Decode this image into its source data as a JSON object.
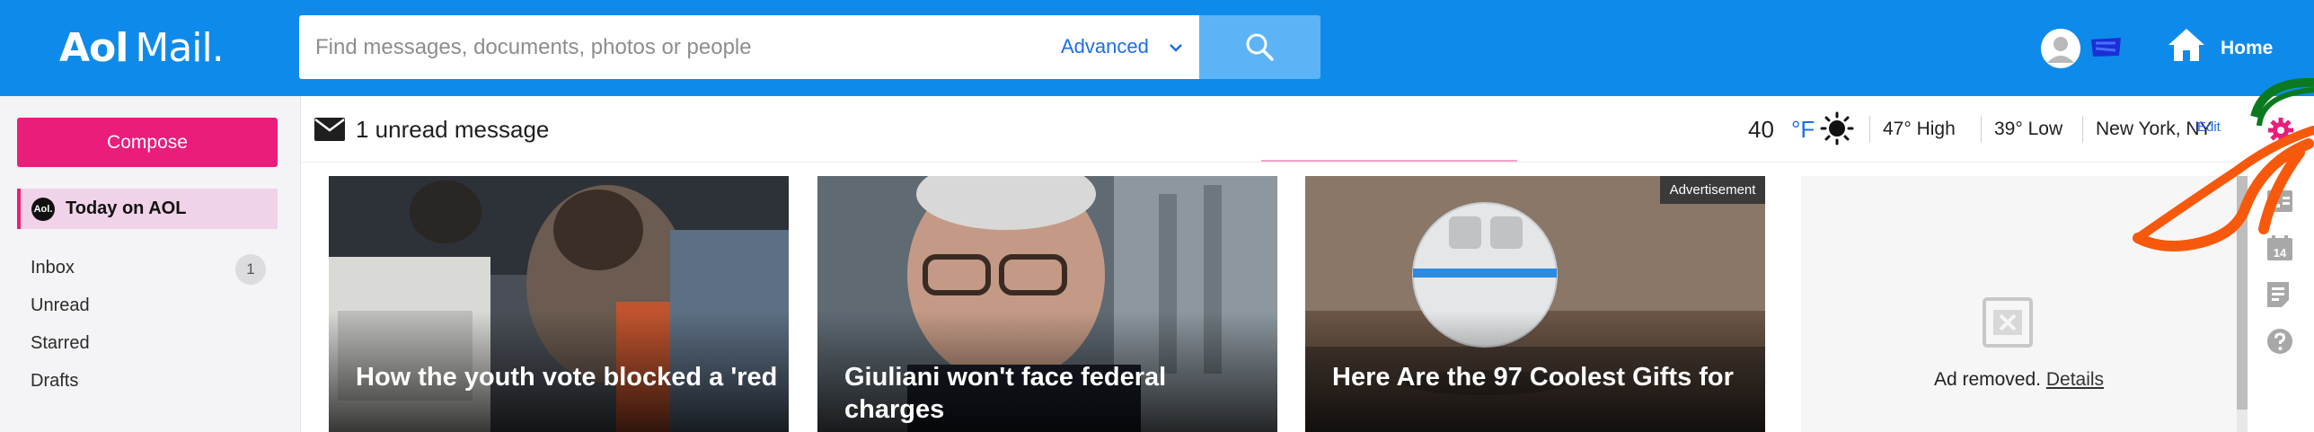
{
  "header": {
    "logo_brand": "Aol",
    "logo_product": "Mail.",
    "search_placeholder": "Find messages, documents, photos or people",
    "advanced_label": "Advanced",
    "home_label": "Home"
  },
  "sidebar": {
    "compose_label": "Compose",
    "today_badge": "Aol.",
    "today_label": "Today on AOL",
    "folders": [
      {
        "label": "Inbox",
        "count": "1"
      },
      {
        "label": "Unread"
      },
      {
        "label": "Starred"
      },
      {
        "label": "Drafts"
      }
    ]
  },
  "main": {
    "unread_label": "1 unread message",
    "weather": {
      "temp": "40",
      "unit": "°F",
      "high": "47° High",
      "low": "39° Low",
      "location": "New York, NY",
      "edit_label": "Edit"
    },
    "cards": [
      {
        "title": "How the youth vote blocked a 'red"
      },
      {
        "title": "Giuliani won't face federal charges"
      },
      {
        "title": "Here Are the 97 Coolest Gifts for",
        "ad_tag": "Advertisement"
      }
    ],
    "ad_removed": {
      "text": "Ad removed.",
      "details_label": "Details"
    }
  },
  "icons": {
    "settings": "gear-icon",
    "contacts": "contacts-icon",
    "calendar": "calendar-icon",
    "calendar_day": "14",
    "notes": "notepad-icon",
    "help": "help-icon"
  },
  "colors": {
    "header_bg": "#0e8bea",
    "accent_pink": "#ea1c7c",
    "link_blue": "#1d6ee8"
  }
}
